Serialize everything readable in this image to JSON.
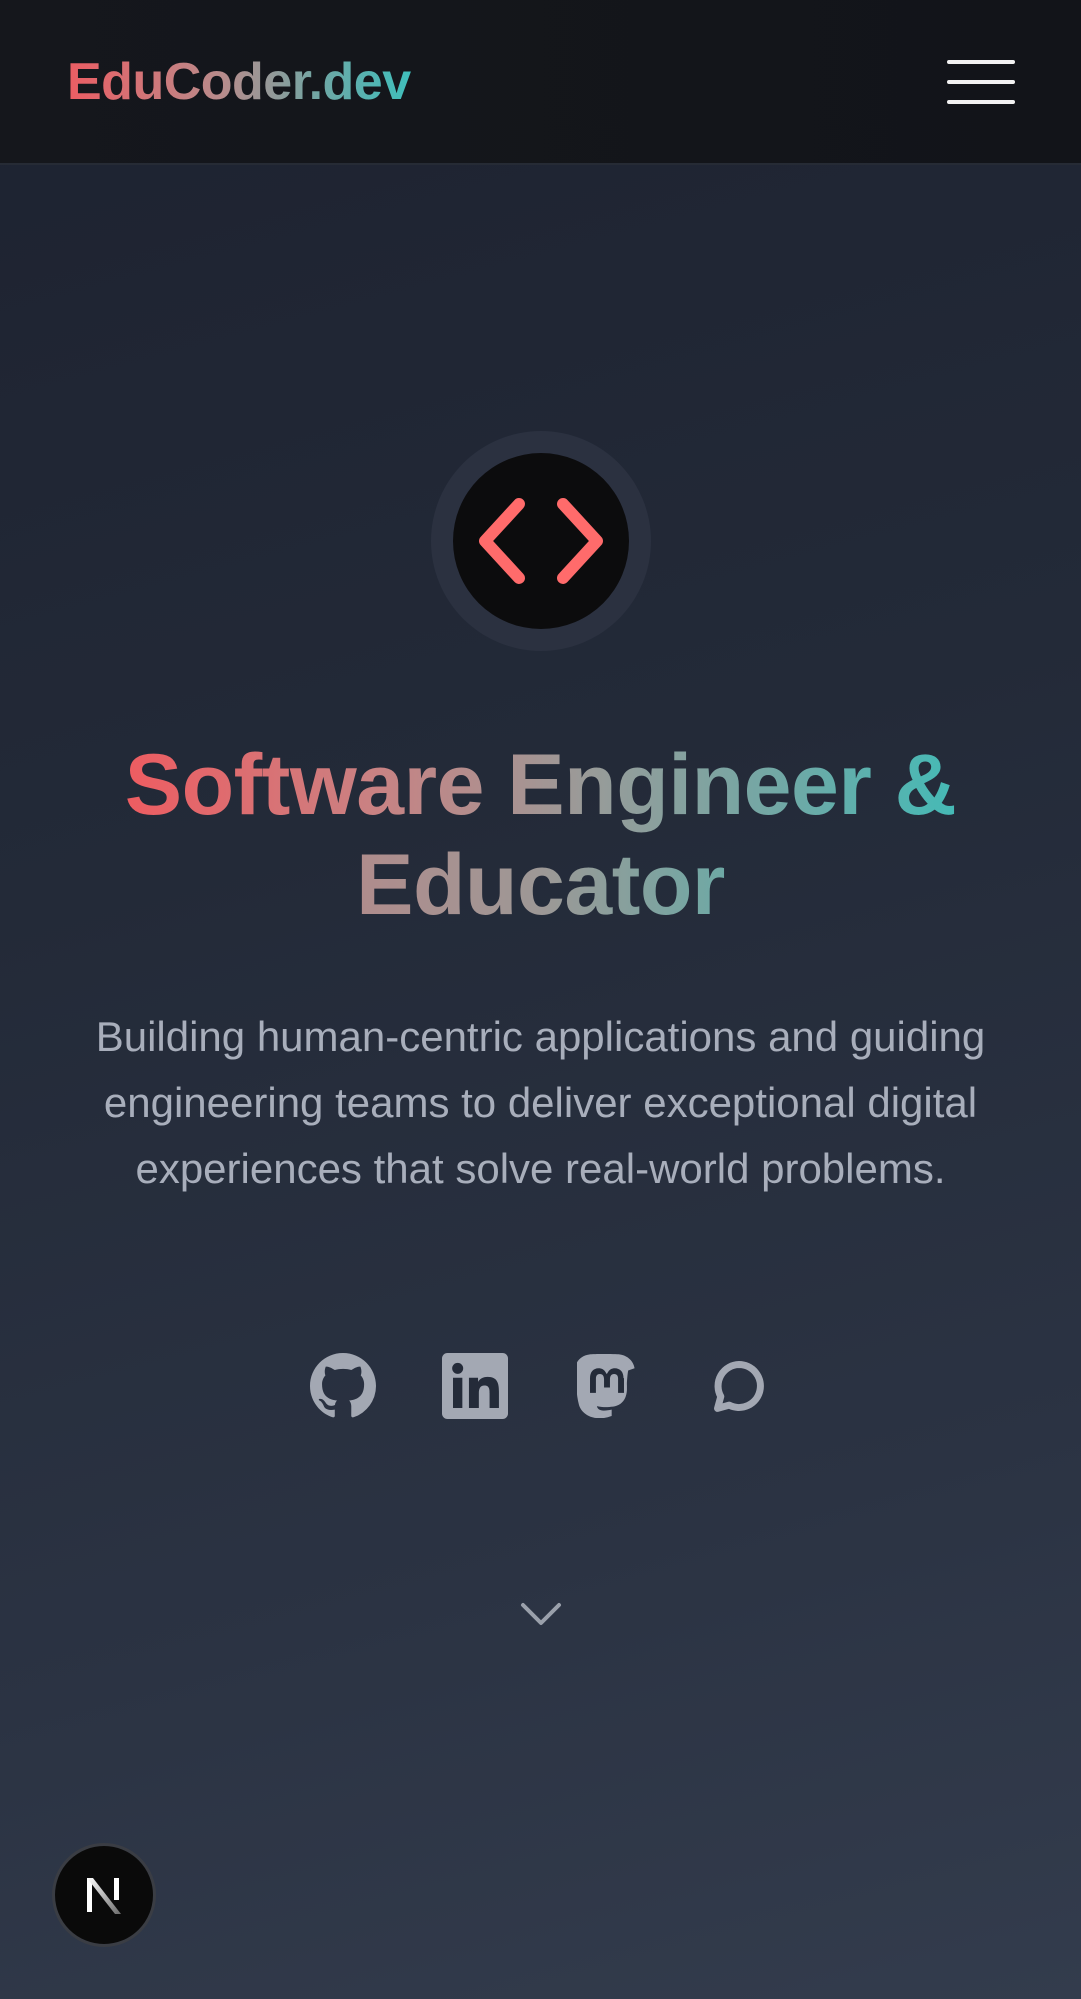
{
  "header": {
    "brand": "EduCoder.dev",
    "menu_icon": "hamburger-menu-icon"
  },
  "hero": {
    "logo_icon": "code-brackets-icon",
    "title_line1": "Software Engineer &",
    "title_line2": "Educator",
    "tagline": "Building human-centric applications and guiding engineering teams to deliver exceptional digital experiences that solve real-world problems.",
    "socials": [
      {
        "icon": "github-icon"
      },
      {
        "icon": "linkedin-icon"
      },
      {
        "icon": "mastodon-icon"
      },
      {
        "icon": "chat-bubble-icon"
      }
    ],
    "scroll_icon": "chevron-down-icon"
  },
  "dev_badge": {
    "letter": "N",
    "icon": "nextjs-icon"
  },
  "colors": {
    "brand_red": "#ec5d63",
    "brand_teal": "#3fbfbc",
    "accent_icon": "#ff6b6b",
    "muted_text": "#a8aebb",
    "social_icon": "#a3a8b3"
  }
}
